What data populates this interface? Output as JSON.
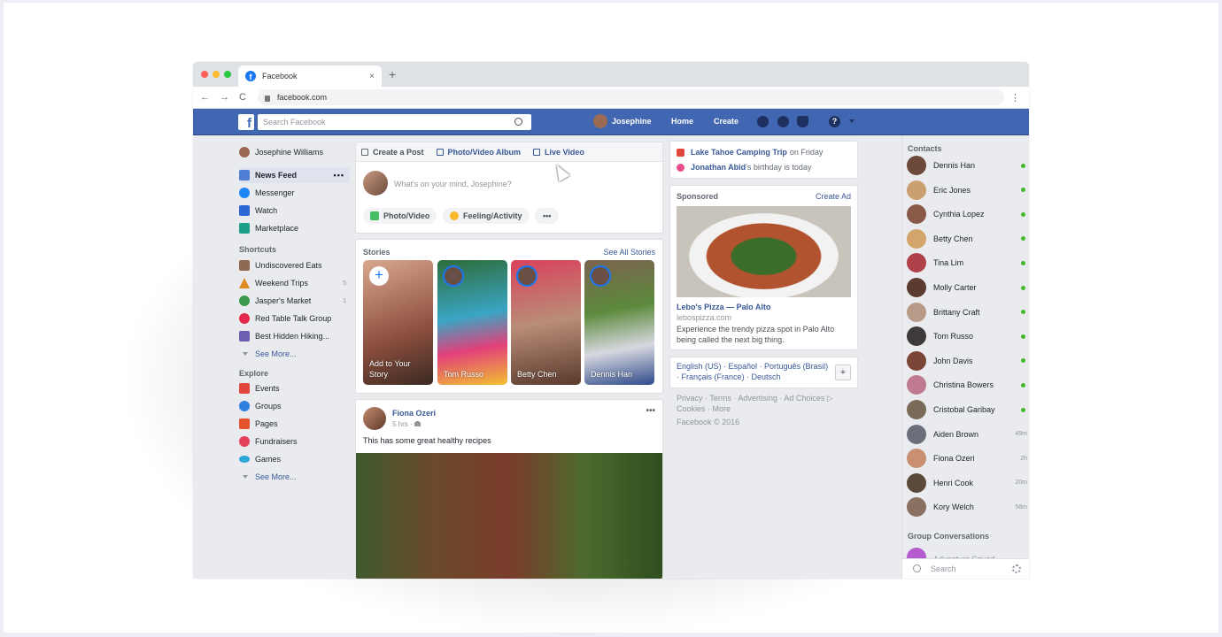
{
  "browser": {
    "tab_title": "Facebook",
    "tab_close": "×",
    "new_tab": "+",
    "url": "facebook.com",
    "nav_back": "←",
    "nav_forward": "→",
    "nav_reload": "C",
    "menu": "⋮"
  },
  "topbar": {
    "logo": "f",
    "search_placeholder": "Search Facebook",
    "user_name": "Josephine",
    "home": "Home",
    "create": "Create",
    "help": "?",
    "brand_color": "#4267b2"
  },
  "left_nav": {
    "profile_name": "Josephine Williams",
    "main": [
      {
        "label": "News Feed",
        "icon": "news-feed-icon",
        "color": "#4e7ed4",
        "active": true,
        "more": "•••"
      },
      {
        "label": "Messenger",
        "icon": "messenger-icon",
        "color": "#1b86f5"
      },
      {
        "label": "Watch",
        "icon": "watch-icon",
        "color": "#2b66d6"
      },
      {
        "label": "Marketplace",
        "icon": "marketplace-icon",
        "color": "#1e9f8a"
      }
    ],
    "shortcuts_title": "Shortcuts",
    "shortcuts": [
      {
        "label": "Undiscovered Eats",
        "icon": "utensils-icon",
        "color": "#8f6a52",
        "count": ""
      },
      {
        "label": "Weekend Trips",
        "icon": "tent-icon",
        "color": "#e08a22",
        "count": "5"
      },
      {
        "label": "Jasper's Market",
        "icon": "market-icon",
        "color": "#3c9a4c",
        "count": "1"
      },
      {
        "label": "Red Table Talk Group",
        "icon": "heart-icon",
        "color": "#e32a4c",
        "count": ""
      },
      {
        "label": "Best Hidden Hiking...",
        "icon": "hiking-icon",
        "color": "#6b5fb0",
        "count": ""
      }
    ],
    "shortcuts_see_more": "See More...",
    "explore_title": "Explore",
    "explore": [
      {
        "label": "Events",
        "icon": "events-icon",
        "color": "#e0463c"
      },
      {
        "label": "Groups",
        "icon": "groups-icon",
        "color": "#2f7fe0"
      },
      {
        "label": "Pages",
        "icon": "pages-icon",
        "color": "#e4542a"
      },
      {
        "label": "Fundraisers",
        "icon": "fundraisers-icon",
        "color": "#e5415b"
      },
      {
        "label": "Games",
        "icon": "games-icon",
        "color": "#2ea8d6"
      }
    ],
    "explore_see_more": "See More..."
  },
  "composer": {
    "tabs": [
      "Create a Post",
      "Photo/Video Album",
      "Live Video"
    ],
    "placeholder": "What's on your mind, Josephine?",
    "buttons": [
      "Photo/Video",
      "Feeling/Activity",
      "•••"
    ]
  },
  "stories": {
    "title": "Stories",
    "see_all": "See All Stories",
    "items": [
      {
        "name": "Add to Your Story",
        "add": "+"
      },
      {
        "name": "Tom Russo"
      },
      {
        "name": "Betty Chen"
      },
      {
        "name": "Dennis Han"
      }
    ]
  },
  "post": {
    "author": "Fiona Ozeri",
    "time": "5 hrs · ",
    "text": "This has some great healthy recipes",
    "more": "•••"
  },
  "right_col": {
    "events": [
      {
        "title": "Lake Tahoe Camping Trip",
        "rest": "on Friday"
      },
      {
        "title": "Jonathan Abid",
        "rest": "'s birthday is today"
      }
    ],
    "sponsored_title": "Sponsored",
    "create_ad": "Create Ad",
    "ad_title": "Lebo's Pizza — Palo Alto",
    "ad_url": "lebospizza.com",
    "ad_desc": "Experience the trendy pizza spot in Palo Alto being called the next big thing.",
    "languages_line1": "English (US) · Español · Português (Brasil)",
    "languages_line2": "· Français (France) · Deutsch",
    "lang_plus": "+",
    "footer1": "Privacy · Terms · Advertising · Ad Choices ▷",
    "footer2": "Cookies · More",
    "footer3": "Facebook © 2016"
  },
  "contacts": {
    "title": "Contacts",
    "items": [
      {
        "name": "Dennis Han",
        "status": "online"
      },
      {
        "name": "Eric Jones",
        "status": "online"
      },
      {
        "name": "Cynthia Lopez",
        "status": "online"
      },
      {
        "name": "Betty Chen",
        "status": "online"
      },
      {
        "name": "Tina Lim",
        "status": "online"
      },
      {
        "name": "Molly Carter",
        "status": "online"
      },
      {
        "name": "Brittany Craft",
        "status": "online"
      },
      {
        "name": "Tom Russo",
        "status": "online"
      },
      {
        "name": "John Davis",
        "status": "online"
      },
      {
        "name": "Christina Bowers",
        "status": "online"
      },
      {
        "name": "Cristobal Garibay",
        "status": "online"
      },
      {
        "name": "Aiden Brown",
        "status": "49m"
      },
      {
        "name": "Fiona Ozeri",
        "status": "2h"
      },
      {
        "name": "Henri Cook",
        "status": "20m"
      },
      {
        "name": "Kory Welch",
        "status": "58m"
      }
    ],
    "group_title": "Group Conversations",
    "group_item": "Adventure Squad",
    "search_placeholder": "Search"
  }
}
